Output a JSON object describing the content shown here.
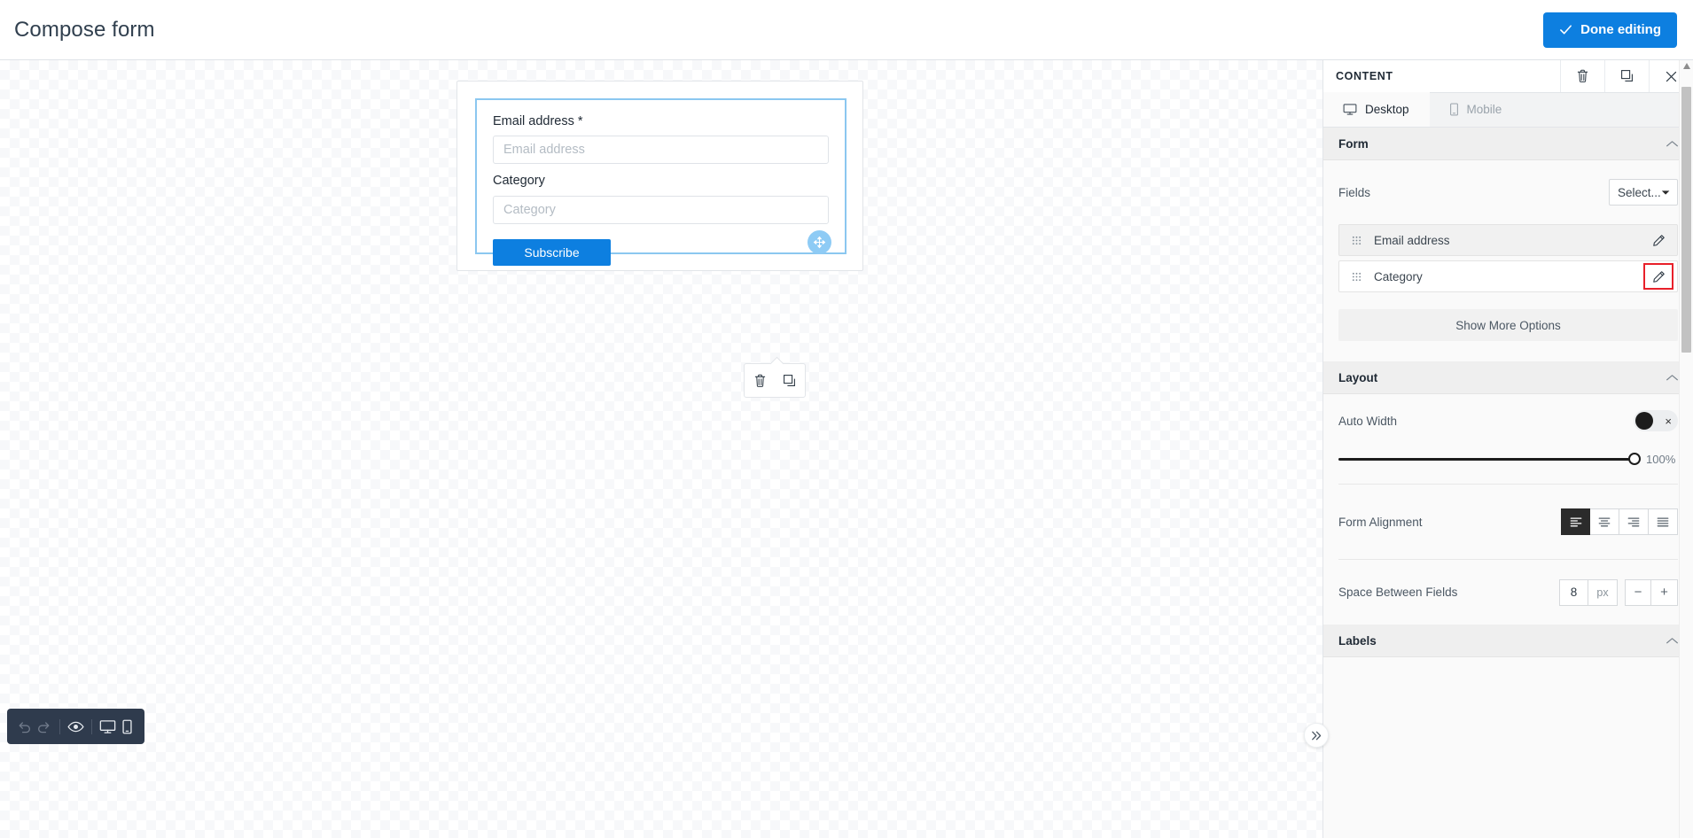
{
  "header": {
    "title": "Compose form",
    "done_button": "Done editing"
  },
  "canvas": {
    "form": {
      "fields": [
        {
          "label": "Email address *",
          "placeholder": "Email address"
        },
        {
          "label": "Category",
          "placeholder": "Category"
        }
      ],
      "submit_label": "Subscribe"
    },
    "float_tools": {
      "delete": "Delete",
      "duplicate": "Duplicate"
    },
    "move_handle": "Move block"
  },
  "bottom_toolbar": {
    "undo": "Undo",
    "redo": "Redo",
    "preview": "Preview",
    "desktop": "Desktop view",
    "mobile": "Mobile view"
  },
  "panel": {
    "title": "CONTENT",
    "actions": {
      "delete": "Delete",
      "duplicate": "Duplicate",
      "close": "Close"
    },
    "tabs": [
      {
        "label": "Desktop",
        "active": true
      },
      {
        "label": "Mobile",
        "active": false
      }
    ],
    "sections": {
      "form": {
        "title": "Form",
        "fields_label": "Fields",
        "fields_select_value": "Select...",
        "field_rows": [
          {
            "name": "Email address",
            "highlighted": false
          },
          {
            "name": "Category",
            "highlighted": true
          }
        ],
        "show_more": "Show More Options"
      },
      "layout": {
        "title": "Layout",
        "auto_width_label": "Auto Width",
        "auto_width_state": "off",
        "width_value": "100%",
        "alignment_label": "Form Alignment",
        "alignment_options": [
          "left",
          "center",
          "right",
          "justify"
        ],
        "alignment_selected": "left",
        "spacing_label": "Space Between Fields",
        "spacing_value": "8",
        "spacing_unit": "px",
        "spacing_minus": "−",
        "spacing_plus": "+"
      },
      "labels": {
        "title": "Labels"
      }
    },
    "collapse": "Collapse panel"
  },
  "colors": {
    "accent": "#0d7fe0",
    "highlight": "#e8202a",
    "selection": "#8bc7f0"
  }
}
